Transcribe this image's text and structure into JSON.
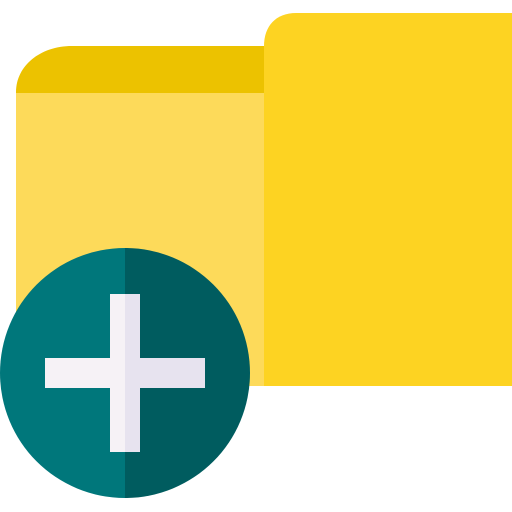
{
  "icon": {
    "name": "add-folder-icon",
    "colors": {
      "background": "#ffffff",
      "folder_tab": "#ECC200",
      "folder_left": "#FDDA5A",
      "folder_right": "#FDD322",
      "circle_left": "#00777B",
      "circle_right": "#005C5F",
      "plus_left": "#F6F2F6",
      "plus_right": "#E7E3EF"
    }
  }
}
